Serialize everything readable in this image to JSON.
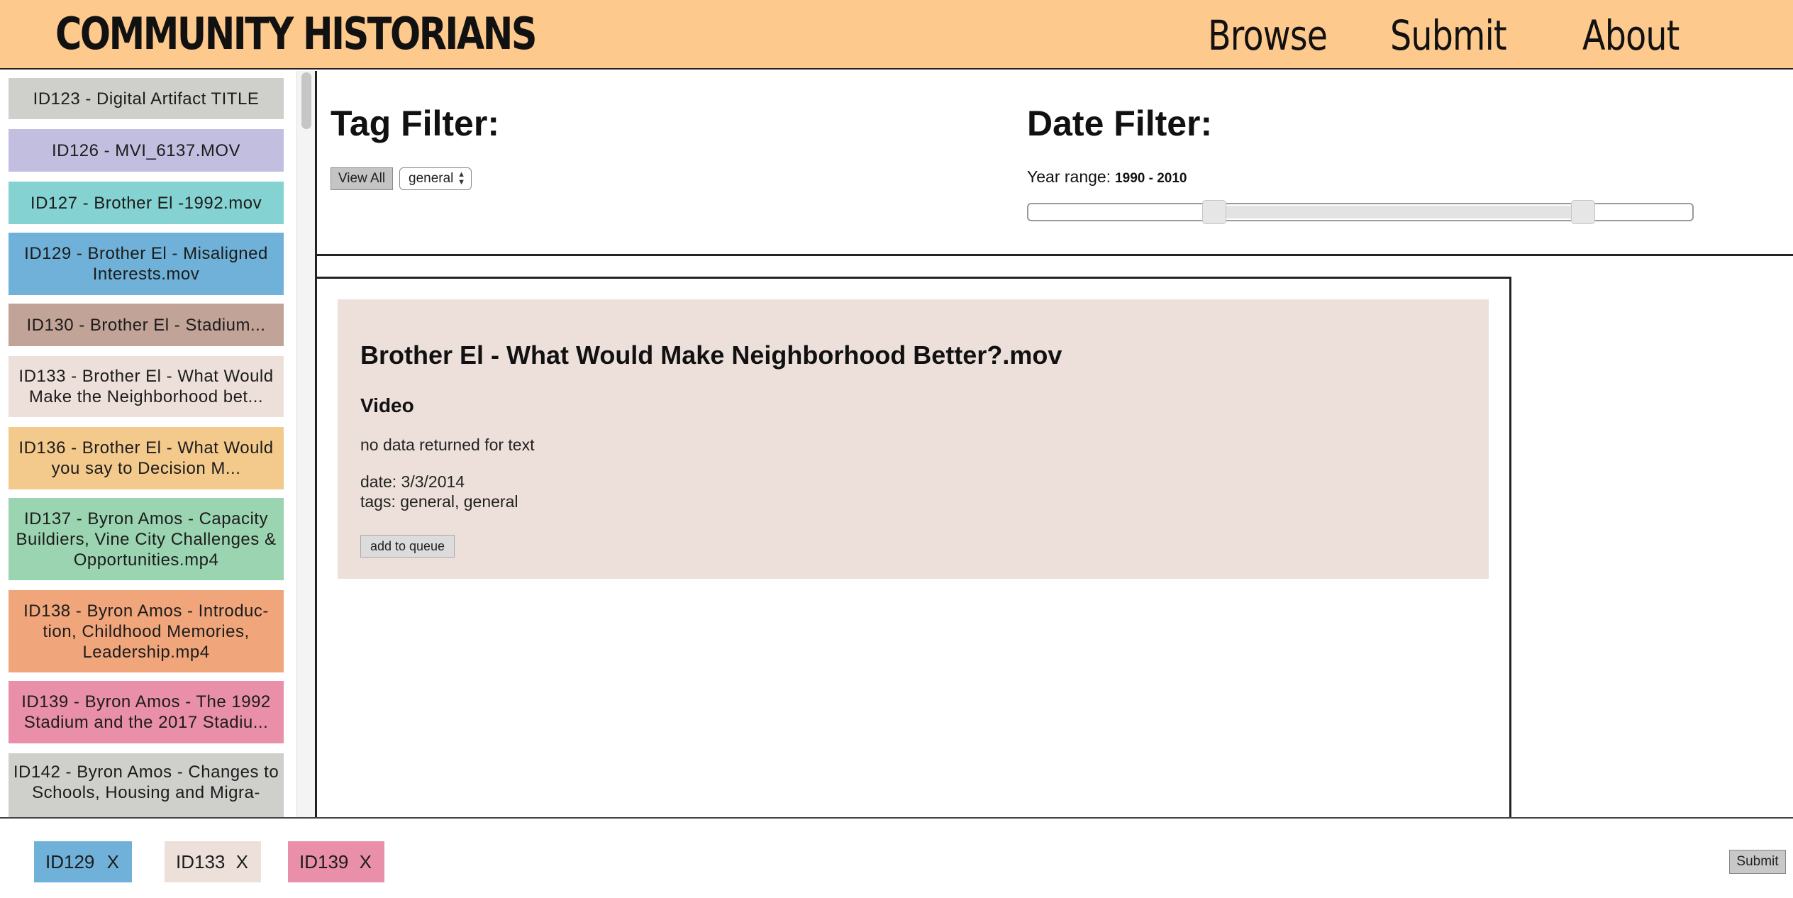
{
  "header": {
    "brand": "COMMUNITY HISTORIANS",
    "nav": {
      "browse": "Browse",
      "submit": "Submit",
      "about": "About"
    },
    "background": "#fec98c"
  },
  "sidebar": {
    "items": [
      {
        "label": "ID123 - Digital Artifact TITLE",
        "color": "#cfcfcc"
      },
      {
        "label": "ID126 - MVI_6137.MOV",
        "color": "#c1bedf"
      },
      {
        "label": "ID127 - Brother El -1992.mov",
        "color": "#84d2d1"
      },
      {
        "label": "ID129 - Brother El - Misaligned Interests.mov",
        "color": "#6fb1d8"
      },
      {
        "label": "ID130 - Brother El - Stadium...",
        "color": "#c2a397"
      },
      {
        "label": "ID133 - Brother El - What Would Make the Neighborhood bet...",
        "color": "#ede0da"
      },
      {
        "label": "ID136 - Brother El - What Would you say to Decision M...",
        "color": "#f4ca8c"
      },
      {
        "label": "ID137 - Byron Amos - Capacity Buildiers, Vine City Challenges & Opportunities.mp4",
        "color": "#9bd4b0"
      },
      {
        "label": "ID138 - Byron Amos - Introduc-tion, Childhood Memories, Leadership.mp4",
        "color": "#f0a57b"
      },
      {
        "label": "ID139 - Byron Amos - The 1992 Stadium and the 2017 Stadiu...",
        "color": "#e98fa9"
      },
      {
        "label": "ID142 - Byron Amos - Changes to Schools, Housing and Migra-",
        "color": "#cfcfcc"
      }
    ]
  },
  "filters": {
    "tag_title": "Tag Filter:",
    "view_all_label": "View All",
    "tag_select_value": "general",
    "date_title": "Date Filter:",
    "year_range_label": "Year range:",
    "year_range_value": "1990 - 2010",
    "slider_low_fraction": 0.28,
    "slider_high_fraction": 0.835
  },
  "card": {
    "title": "Brother El - What Would Make Neighborhood Better?.mov",
    "type": "Video",
    "text": "no data returned for text",
    "date": "date: 3/3/2014",
    "tags": "tags: general, general",
    "queue_button": "add to queue",
    "background": "#ede0da"
  },
  "queue": {
    "items": [
      {
        "label": "ID129",
        "remove": "X",
        "color": "#6fb1d8"
      },
      {
        "label": "ID133",
        "remove": "X",
        "color": "#ede0da"
      },
      {
        "label": "ID139",
        "remove": "X",
        "color": "#e98fa9"
      }
    ],
    "submit_label": "Submit"
  }
}
